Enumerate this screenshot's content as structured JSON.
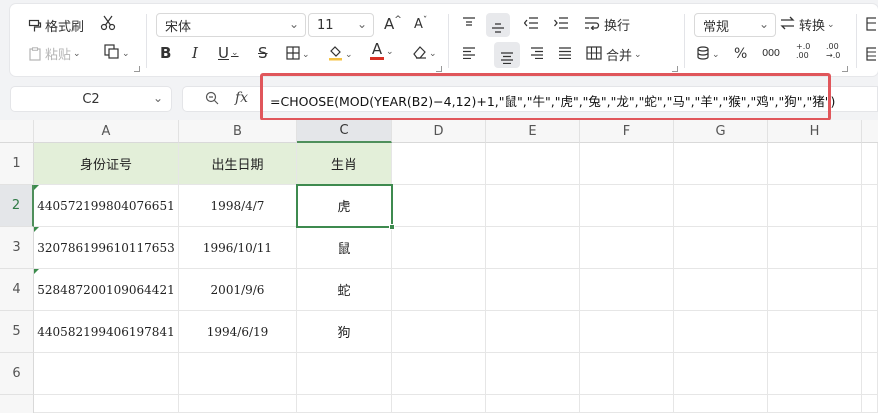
{
  "ribbon": {
    "format_painter": "格式刷",
    "paste": "粘贴",
    "font_name": "宋体",
    "font_size": "11",
    "bold": "B",
    "italic": "I",
    "underline": "U",
    "strike": "S",
    "font_color_letter": "A",
    "increase_font": "A",
    "decrease_font": "A",
    "wrap": "换行",
    "merge": "合并",
    "number_format": "常规",
    "convert": "转换",
    "percent": "%",
    "thousands": "000",
    "inc_dec": "+.0\n.00",
    "dec_dec": ".00\n→.0",
    "font_color_hex": "#d93025",
    "accent": "#3e8a4f"
  },
  "formula_bar": {
    "name_box": "C2",
    "fx": "fx",
    "formula": "=CHOOSE(MOD(YEAR(B2)−4,12)+1,\"鼠\",\"牛\",\"虎\",\"兔\",\"龙\",\"蛇\",\"马\",\"羊\",\"猴\",\"鸡\",\"狗\",\"猪\")"
  },
  "columns": [
    "A",
    "B",
    "C",
    "D",
    "E",
    "F",
    "G",
    "H"
  ],
  "rows": [
    "1",
    "2",
    "3",
    "4",
    "5",
    "6"
  ],
  "table": {
    "headers": [
      "身份证号",
      "出生日期",
      "生肖"
    ],
    "data": [
      [
        "440572199804076651",
        "1998/4/7",
        "虎"
      ],
      [
        "320786199610117653",
        "1996/10/11",
        "鼠"
      ],
      [
        "528487200109064421",
        "2001/9/6",
        "蛇"
      ],
      [
        "440582199406197841",
        "1994/6/19",
        "狗"
      ]
    ]
  }
}
